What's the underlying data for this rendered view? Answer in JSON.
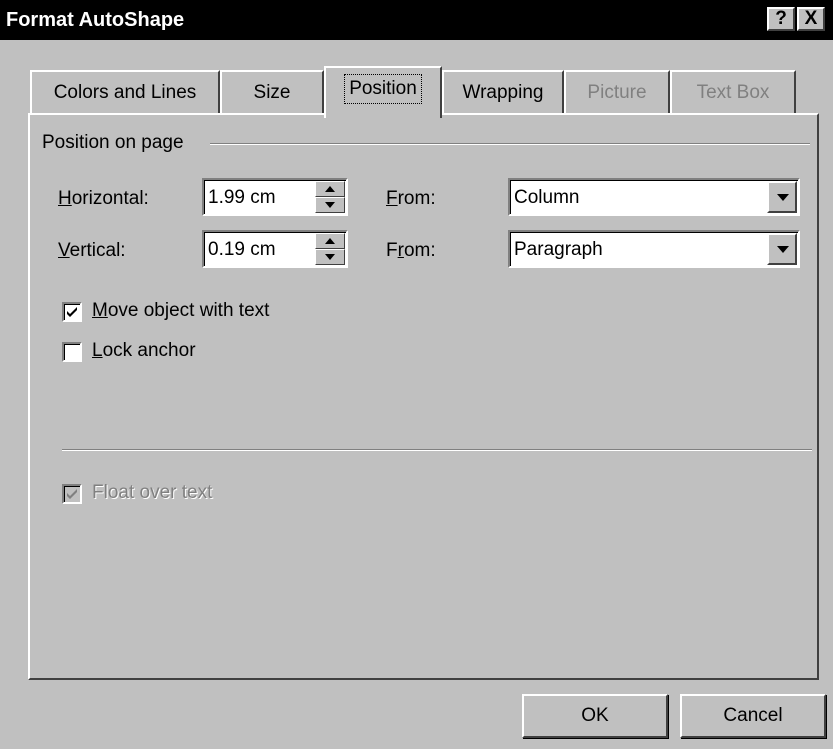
{
  "window": {
    "title": "Format AutoShape",
    "help_label": "?",
    "close_label": "X"
  },
  "tabs": [
    {
      "label": "Colors and Lines",
      "state": "normal"
    },
    {
      "label": "Size",
      "state": "normal"
    },
    {
      "label": "Position",
      "state": "active"
    },
    {
      "label": "Wrapping",
      "state": "normal"
    },
    {
      "label": "Picture",
      "state": "disabled"
    },
    {
      "label": "Text Box",
      "state": "disabled"
    }
  ],
  "position": {
    "group_title": "Position on page",
    "horizontal": {
      "label_hotkey": "H",
      "label_rest": "orizontal:",
      "value": "1.99 cm",
      "from_label_hotkey": "F",
      "from_label_rest": "rom:",
      "from_value": "Column"
    },
    "vertical": {
      "label_hotkey": "V",
      "label_rest": "ertical:",
      "value": "0.19 cm",
      "from_label_pre": "F",
      "from_label_hotkey": "r",
      "from_label_rest": "om:",
      "from_value": "Paragraph"
    },
    "move_with_text": {
      "label_hotkey": "M",
      "label_rest": "ove object with text",
      "checked": true
    },
    "lock_anchor": {
      "label_hotkey": "L",
      "label_rest": "ock anchor",
      "checked": false
    },
    "float_over_text": {
      "label": "Float over text",
      "checked": true,
      "enabled": false
    }
  },
  "buttons": {
    "ok": "OK",
    "cancel": "Cancel"
  }
}
